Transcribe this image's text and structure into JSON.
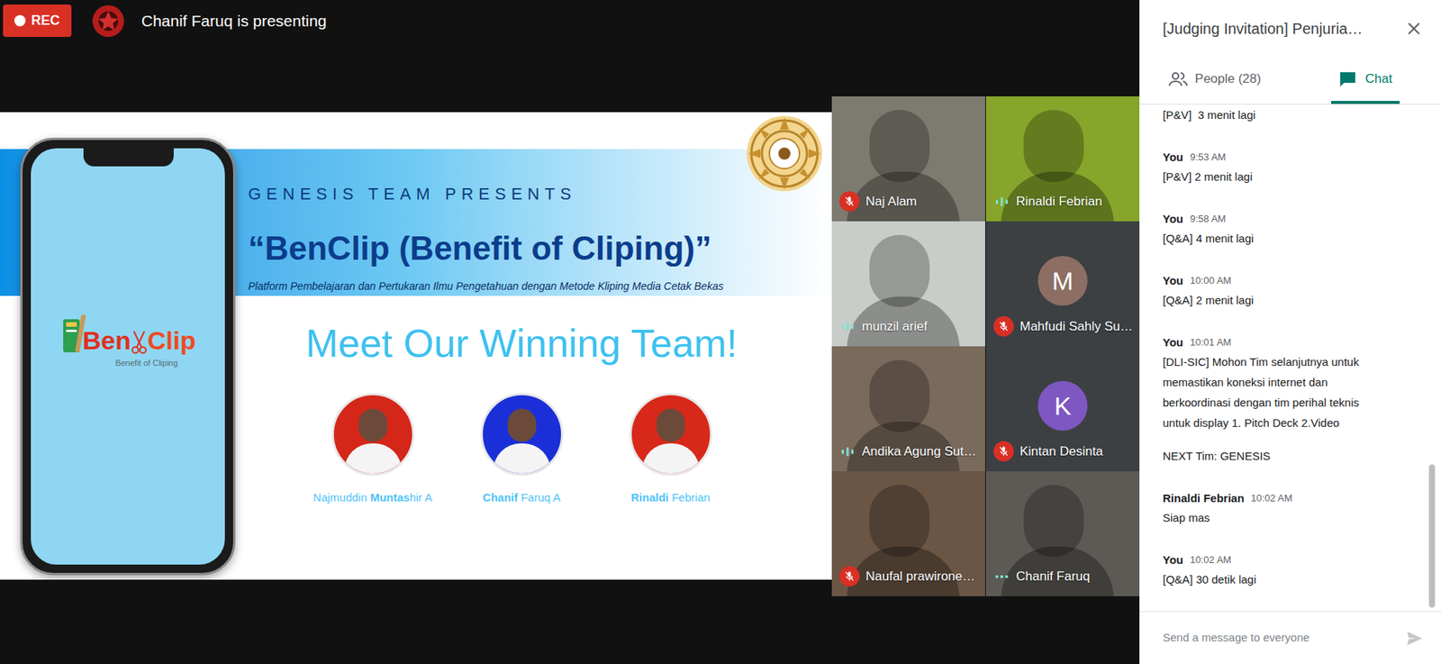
{
  "top_bar": {
    "recording": "REC",
    "presenter": "Chanif Faruq is presenting"
  },
  "slide": {
    "logo": {
      "word1": "Ben",
      "word2": "Clip",
      "tagline": "Benefit of Cliping"
    },
    "kicker": "GENESIS TEAM PRESENTS",
    "title": "“BenClip (Benefit of Cliping)”",
    "subtitle": "Platform Pembelajaran dan Pertukaran Ilmu Pengetahuan dengan Metode Kliping Media Cetak Bekas",
    "heading": "Meet Our Winning Team!",
    "members": [
      {
        "parts": [
          {
            "text": "Najmuddin ",
            "bold": false
          },
          {
            "text": "Muntas",
            "bold": true
          },
          {
            "text": "hir A",
            "bold": false
          }
        ]
      },
      {
        "parts": [
          {
            "text": "Chanif",
            "bold": true
          },
          {
            "text": " Faruq A",
            "bold": false
          }
        ]
      },
      {
        "parts": [
          {
            "text": "Rinaldi",
            "bold": true
          },
          {
            "text": " Febrian",
            "bold": false
          }
        ]
      }
    ]
  },
  "participants": [
    {
      "name": "Naj Alam",
      "kind": "video",
      "mic": "muted"
    },
    {
      "name": "Rinaldi Febrian",
      "kind": "video",
      "mic": "speaking"
    },
    {
      "name": "munzil arief",
      "kind": "video",
      "mic": "speaking"
    },
    {
      "name": "Mahfudi Sahly Su…",
      "kind": "avatar",
      "initial": "M",
      "color": "#8d6e63",
      "mic": "muted"
    },
    {
      "name": "Andika Agung Sut…",
      "kind": "video",
      "mic": "speaking"
    },
    {
      "name": "Kintan Desinta",
      "kind": "avatar",
      "initial": "K",
      "color": "#7e57c2",
      "mic": "muted"
    },
    {
      "name": "Naufal prawirone…",
      "kind": "video",
      "mic": "muted"
    },
    {
      "name": "Chanif Faruq",
      "kind": "video",
      "mic": "idle"
    }
  ],
  "chat": {
    "title": "[Judging Invitation] Penjuria…",
    "tabs": [
      {
        "label": "People (28)",
        "selected": false
      },
      {
        "label": "Chat",
        "selected": true
      }
    ],
    "messages": [
      {
        "lines": [
          "[P&V]  3 menit lagi"
        ]
      },
      {
        "sender": "You",
        "time": "9:53 AM",
        "lines": [
          "[P&V] 2 menit lagi"
        ]
      },
      {
        "sender": "You",
        "time": "9:58 AM",
        "lines": [
          "[Q&A] 4 menit lagi"
        ]
      },
      {
        "sender": "You",
        "time": "10:00 AM",
        "lines": [
          "[Q&A] 2 menit lagi"
        ]
      },
      {
        "sender": "You",
        "time": "10:01 AM",
        "lines": [
          "[DLI-SIC] Mohon Tim selanjutnya untuk",
          "memastikan koneksi internet dan",
          "berkoordinasi dengan tim perihal teknis",
          "untuk display 1. Pitch Deck 2.Video",
          "",
          "NEXT Tim: GENESIS"
        ]
      },
      {
        "sender": "Rinaldi Febrian",
        "time": "10:02 AM",
        "lines": [
          "Siap mas"
        ]
      },
      {
        "sender": "You",
        "time": "10:02 AM",
        "lines": [
          "[Q&A] 30 detik lagi"
        ]
      }
    ],
    "input": {
      "placeholder": "Send a message to everyone"
    }
  }
}
